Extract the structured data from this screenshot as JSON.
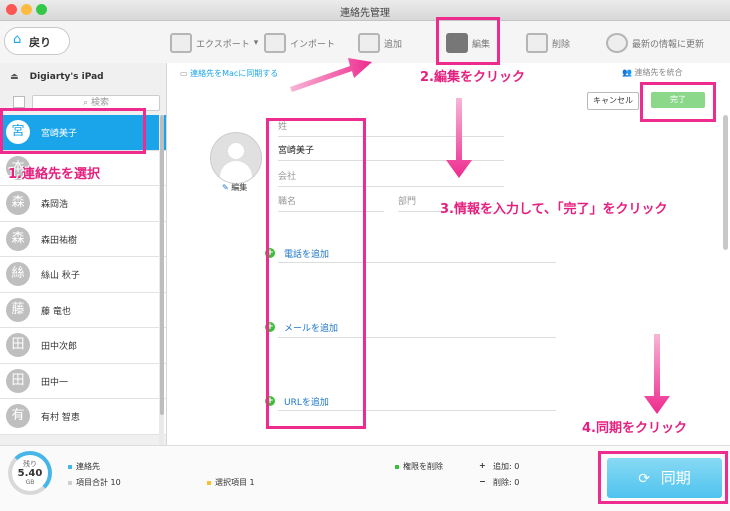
{
  "window": {
    "title": "連絡先管理"
  },
  "toolbar": {
    "back_label": "戻り",
    "export_label": "エクスポート",
    "import_label": "インポート",
    "add_label": "追加",
    "edit_label": "編集",
    "delete_label": "削除",
    "refresh_label": "最新の情報に更新"
  },
  "sidebar": {
    "device_name": "Digiarty's iPad",
    "search_placeholder": "検索",
    "contacts": [
      {
        "initial": "宮",
        "name": "宮崎美子"
      },
      {
        "initial": "本",
        "name": ""
      },
      {
        "initial": "森",
        "name": "森岡浩"
      },
      {
        "initial": "森",
        "name": "森田祐樹"
      },
      {
        "initial": "絲",
        "name": "絲山 秋子"
      },
      {
        "initial": "藤",
        "name": "藤 竜也"
      },
      {
        "initial": "田",
        "name": "田中次郎"
      },
      {
        "initial": "田",
        "name": "田中一"
      },
      {
        "initial": "有",
        "name": "有村 智恵"
      }
    ]
  },
  "main": {
    "sync_mac_label": "連絡先をMacに同期する",
    "merge_label": "連絡先を統合",
    "cancel_label": "キャンセル",
    "done_label": "完了",
    "photo_edit_label": "編集",
    "fields": {
      "sei": "姓",
      "mei_value": "宮崎美子",
      "company": "会社",
      "title": "職名",
      "dept": "部門"
    },
    "add_phone": "電話を追加",
    "add_mail": "メールを追加",
    "add_url": "URLを追加"
  },
  "footer": {
    "storage_label": "残り",
    "storage_value": "5.40",
    "storage_unit": "GB",
    "contacts_label": "連絡先",
    "total_label": "項目合計 10",
    "selected_label": "選択項目 1",
    "perm_delete_label": "権限を削除",
    "add_count_label": "追加: 0",
    "delete_count_label": "削除: 0",
    "plus_sign": "+",
    "minus_sign": "−",
    "sync_label": "同期"
  },
  "annotations": {
    "step1": "1.連絡先を選択",
    "step2": "2.編集をクリック",
    "step3": "3.情報を入力して、「完了」をクリック",
    "step4": "4.同期をクリック"
  },
  "colors": {
    "accent": "#1aa5ea",
    "annotation": "#ee2b8f",
    "done": "#8cd88a",
    "add_plus": "#3bbf3b"
  }
}
